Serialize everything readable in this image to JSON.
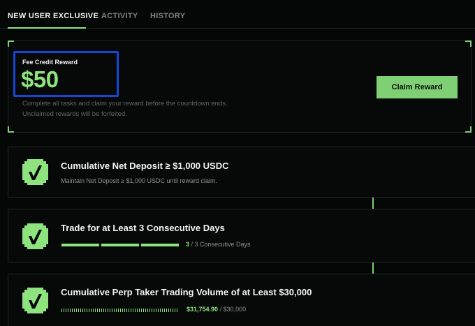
{
  "tabs": [
    {
      "label": "NEW USER EXCLUSIVE",
      "active": true
    },
    {
      "label": "ACTIVITY",
      "active": false
    },
    {
      "label": "HISTORY",
      "active": false
    }
  ],
  "reward": {
    "label": "Fee Credit Reward",
    "amount": "$50",
    "description_line1": "Complete all tasks and claim your reward before the countdown ends.",
    "description_line2": "Unclaimed rewards will be forfeited.",
    "claim_label": "Claim Reward"
  },
  "tasks": [
    {
      "title": "Cumulative Net Deposit ≥ $1,000 USDC",
      "subtitle": "Maintain Net Deposit ≥ $1,000 USDC until reward claim.",
      "completed": true,
      "icon": "check-badge-icon"
    },
    {
      "title": "Trade for at Least 3 Consecutive Days",
      "progress_current": "3",
      "progress_suffix": " / 3 Consecutive Days",
      "progress_fraction": 1.0,
      "completed": true,
      "icon": "check-badge-icon"
    },
    {
      "title": "Cumulative Perp Taker Trading Volume of at Least $30,000",
      "progress_current": "$31,754.90",
      "progress_suffix": " / $30,000",
      "progress_fraction": 1.0,
      "completed": true,
      "icon": "check-badge-icon"
    }
  ],
  "colors": {
    "accent": "#8fe37f",
    "button": "#7fcf74",
    "highlight": "#1446d8",
    "background": "#050606"
  }
}
